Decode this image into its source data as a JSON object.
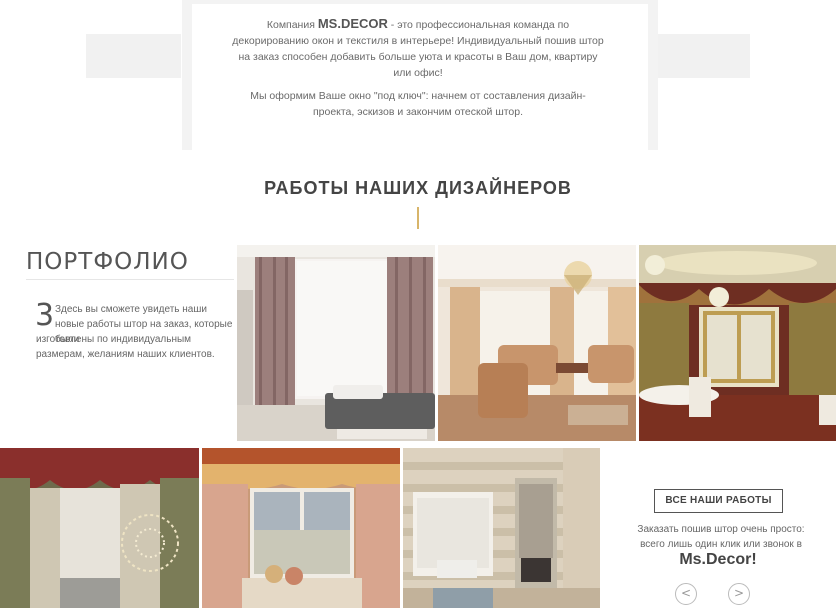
{
  "intro": {
    "prefix": "Компания ",
    "brand": "MS.DECOR",
    "paragraph1_rest": " - это профессиональная команда по декорированию окон и текстиля в интерьере! Индивидуальный пошив штор на заказ способен добавить больше уюта и красоты в Ваш дом, квартиру или офис!",
    "paragraph2": "Мы оформим Ваше окно \"под ключ\": начнем от составления дизайн-проекта, эскизов и закончим отеской штор."
  },
  "section": {
    "title": "РАБОТЫ НАШИХ ДИЗАЙНЕРОВ"
  },
  "portfolio": {
    "heading": "ПОРТФОЛИО",
    "number": "3",
    "desc_line1": "Здесь вы сможете увидеть наши новые работы штор на заказ, которые были",
    "desc_line2": "изготовлены по индивидуальным размерам, желаниям наших клиентов."
  },
  "cta": {
    "all_works": "ВСЕ НАШИ РАБОТЫ",
    "text": "Заказать пошив штор очень просто: всего лишь один клик или звонок в",
    "brand": "Ms.Decor!",
    "prev": "<",
    "next": ">"
  },
  "colors": {
    "accent_line": "#d8b56a",
    "text_main": "#555555"
  }
}
